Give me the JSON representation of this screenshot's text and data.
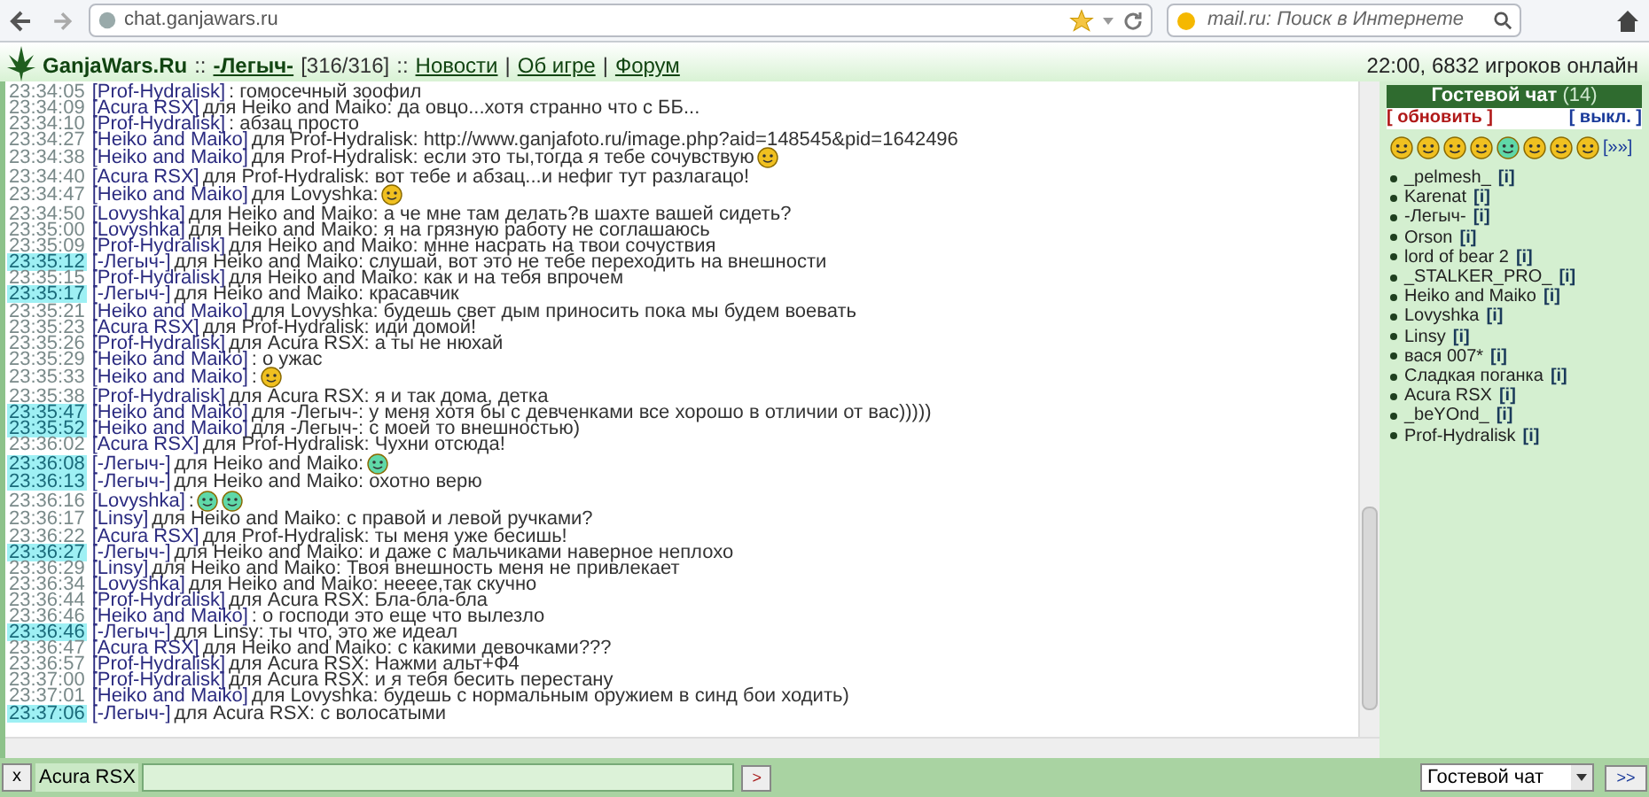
{
  "browser": {
    "url": "chat.ganjawars.ru",
    "search_placeholder": "mail.ru: Поиск в Интернете"
  },
  "header": {
    "site": "GanjaWars.Ru",
    "sep1": "::",
    "user": "-Легыч-",
    "hp": "[316/316]",
    "sep2": "::",
    "links": [
      {
        "label": "Новости"
      },
      {
        "label": "Об игре"
      },
      {
        "label": "Форум"
      }
    ],
    "divider": "|",
    "online": "22:00, 6832 игроков онлайн"
  },
  "messages": [
    {
      "time": "23:34:05",
      "highlight": false,
      "author": "[Prof-Hydralisk]",
      "text": ": гомосечный зоофил"
    },
    {
      "time": "23:34:09",
      "highlight": false,
      "author": "[Acura RSX]",
      "text": "для Heiko and Maiko: да овцо...хотя странно что с ББ..."
    },
    {
      "time": "23:34:10",
      "highlight": false,
      "author": "[Prof-Hydralisk]",
      "text": ": абзац просто"
    },
    {
      "time": "23:34:27",
      "highlight": false,
      "author": "[Heiko and Maiko]",
      "text": "для Prof-Hydralisk: http://www.ganjafoto.ru/image.php?aid=148545&pid=1642496"
    },
    {
      "time": "23:34:38",
      "highlight": false,
      "author": "[Heiko and Maiko]",
      "text": "для Prof-Hydralisk: если это ты,тогда я тебе сочувствую",
      "smileys": [
        {
          "color": "#f0c020"
        }
      ]
    },
    {
      "time": "23:34:40",
      "highlight": false,
      "author": "[Acura RSX]",
      "text": "для Prof-Hydralisk: вот тебе и абзац...и нефиг тут разлагацо!"
    },
    {
      "time": "23:34:47",
      "highlight": false,
      "author": "[Heiko and Maiko]",
      "text": "для Lovyshka:",
      "smileys": [
        {
          "color": "#f0c020"
        }
      ]
    },
    {
      "time": "23:34:50",
      "highlight": false,
      "author": "[Lovyshka]",
      "text": "для Heiko and Maiko: а че мне там делать?в шахте вашей сидеть?"
    },
    {
      "time": "23:35:00",
      "highlight": false,
      "author": "[Lovyshka]",
      "text": "для Heiko and Maiko: я на грязную работу не соглашаюсь"
    },
    {
      "time": "23:35:09",
      "highlight": false,
      "author": "[Prof-Hydralisk]",
      "text": "для Heiko and Maiko: мнне насрать на твои сочуствия"
    },
    {
      "time": "23:35:12",
      "highlight": true,
      "author": "[-Легыч-]",
      "text": "для Heiko and Maiko: слушай, вот это не тебе переходить на внешности"
    },
    {
      "time": "23:35:15",
      "highlight": false,
      "author": "[Prof-Hydralisk]",
      "text": "для Heiko and Maiko: как и на тебя впрочем"
    },
    {
      "time": "23:35:17",
      "highlight": true,
      "author": "[-Легыч-]",
      "text": "для Heiko and Maiko: красавчик"
    },
    {
      "time": "23:35:21",
      "highlight": false,
      "author": "[Heiko and Maiko]",
      "text": "для Lovyshka: будешь свет дым приносить пока мы будем воевать"
    },
    {
      "time": "23:35:23",
      "highlight": false,
      "author": "[Acura RSX]",
      "text": "для Prof-Hydralisk: иди домой!"
    },
    {
      "time": "23:35:26",
      "highlight": false,
      "author": "[Prof-Hydralisk]",
      "text": "для Acura RSX: а ты не нюхай"
    },
    {
      "time": "23:35:29",
      "highlight": false,
      "author": "[Heiko and Maiko]",
      "text": ": о ужас"
    },
    {
      "time": "23:35:33",
      "highlight": false,
      "author": "[Heiko and Maiko]",
      "text": ":",
      "smileys": [
        {
          "color": "#f0c020"
        }
      ]
    },
    {
      "time": "23:35:38",
      "highlight": false,
      "author": "[Prof-Hydralisk]",
      "text": "для Acura RSX: я и так дома, детка"
    },
    {
      "time": "23:35:47",
      "highlight": true,
      "author": "[Heiko and Maiko]",
      "text": "для -Легыч-: у меня хотя бы с девченками все хорошо в отличии от вас)))))"
    },
    {
      "time": "23:35:52",
      "highlight": true,
      "author": "[Heiko and Maiko]",
      "text": "для -Легыч-: с моей то внешностью)"
    },
    {
      "time": "23:36:02",
      "highlight": false,
      "author": "[Acura RSX]",
      "text": "для Prof-Hydralisk: Чухни отсюда!"
    },
    {
      "time": "23:36:08",
      "highlight": true,
      "author": "[-Легыч-]",
      "text": "для Heiko and Maiko:",
      "smileys": [
        {
          "color": "#5fd8a8"
        }
      ]
    },
    {
      "time": "23:36:13",
      "highlight": true,
      "author": "[-Легыч-]",
      "text": "для Heiko and Maiko: охотно верю"
    },
    {
      "time": "23:36:16",
      "highlight": false,
      "author": "[Lovyshka]",
      "text": ":",
      "smileys": [
        {
          "color": "#5fd8a8"
        },
        {
          "color": "#5fd8a8"
        }
      ]
    },
    {
      "time": "23:36:17",
      "highlight": false,
      "author": "[Linsy]",
      "text": "для Heiko and Maiko: с правой и левой ручками?"
    },
    {
      "time": "23:36:22",
      "highlight": false,
      "author": "[Acura RSX]",
      "text": "для Prof-Hydralisk: ты меня уже бесишь!"
    },
    {
      "time": "23:36:27",
      "highlight": true,
      "author": "[-Легыч-]",
      "text": "для Heiko and Maiko: и даже с мальчиками наверное неплохо"
    },
    {
      "time": "23:36:29",
      "highlight": false,
      "author": "[Linsy]",
      "text": "для Heiko and Maiko: Твоя внешность меня не привлекает"
    },
    {
      "time": "23:36:34",
      "highlight": false,
      "author": "[Lovyshka]",
      "text": "для Heiko and Maiko: нееее,так скучно"
    },
    {
      "time": "23:36:44",
      "highlight": false,
      "author": "[Prof-Hydralisk]",
      "text": "для Acura RSX: Бла-бла-бла"
    },
    {
      "time": "23:36:46",
      "highlight": false,
      "author": "[Heiko and Maiko]",
      "text": ": о господи это еще что вылезло"
    },
    {
      "time": "23:36:46",
      "highlight": true,
      "author": "[-Легыч-]",
      "text": "для Linsy: ты что, это же идеал"
    },
    {
      "time": "23:36:47",
      "highlight": false,
      "author": "[Acura RSX]",
      "text": "для Heiko and Maiko: с какими девочками???"
    },
    {
      "time": "23:36:57",
      "highlight": false,
      "author": "[Prof-Hydralisk]",
      "text": "для Acura RSX: Нажми альт+Ф4"
    },
    {
      "time": "23:37:00",
      "highlight": false,
      "author": "[Prof-Hydralisk]",
      "text": "для Acura RSX: и я тебя бесить перестану"
    },
    {
      "time": "23:37:01",
      "highlight": false,
      "author": "[Heiko and Maiko]",
      "text": "для Lovyshka: будешь с нормальным оружием в синд бои ходить)"
    },
    {
      "time": "23:37:06",
      "highlight": true,
      "author": "[-Легыч-]",
      "text": "для Acura RSX: с волосатыми"
    }
  ],
  "sidebar": {
    "title": "Гостевой чат",
    "count": "(14)",
    "refresh": "[ обновить ]",
    "off": "[ выкл. ]",
    "smileys": [
      {
        "color": "#f0c020"
      },
      {
        "color": "#f0c020"
      },
      {
        "color": "#f0c020"
      },
      {
        "color": "#f0c020"
      },
      {
        "color": "#5fd8a8"
      },
      {
        "color": "#f0c020"
      },
      {
        "color": "#f0c020"
      },
      {
        "color": "#f0c020"
      }
    ],
    "more": "[»»]",
    "users": [
      {
        "name": "_pelmesh_",
        "info": "[i]"
      },
      {
        "name": "Karenat",
        "info": "[i]"
      },
      {
        "name": "-Легыч-",
        "info": "[i]"
      },
      {
        "name": "Orson",
        "info": "[i]"
      },
      {
        "name": "lord of bear 2",
        "info": "[i]"
      },
      {
        "name": "_STALKER_PRO_",
        "info": "[i]"
      },
      {
        "name": "Heiko and Maiko",
        "info": "[i]"
      },
      {
        "name": "Lovyshka",
        "info": "[i]"
      },
      {
        "name": "Linsy",
        "info": "[i]"
      },
      {
        "name": "вася 007*",
        "info": "[i]"
      },
      {
        "name": "Сладкая поганка",
        "info": "[i]"
      },
      {
        "name": "Acura RSX",
        "info": "[i]"
      },
      {
        "name": "_beYOnd_",
        "info": "[i]"
      },
      {
        "name": "Prof-Hydralisk",
        "info": "[i]"
      }
    ]
  },
  "footer": {
    "clear": "x",
    "recipient": "Acura RSX",
    "send": ">",
    "channel": "Гостевой чат",
    "go": ">>"
  }
}
